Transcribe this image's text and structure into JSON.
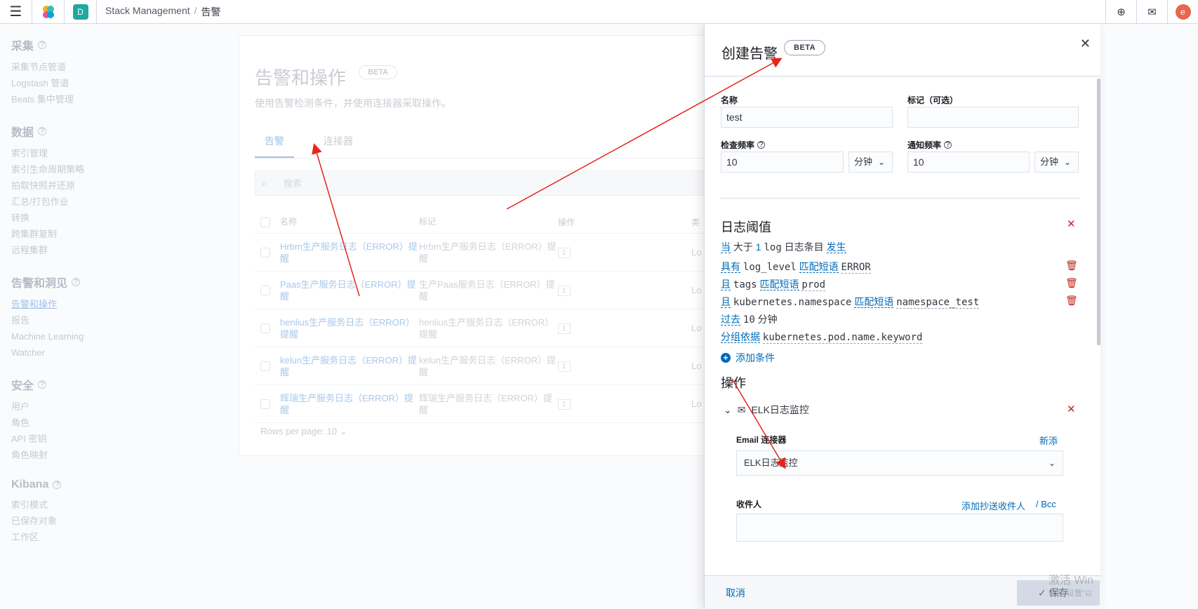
{
  "header": {
    "space_initial": "D",
    "breadcrumbs": [
      "Stack Management",
      "告警"
    ],
    "avatar_initial": "e",
    "icons": [
      "menu-icon",
      "elastic-logo",
      "help-icon",
      "mail-icon"
    ]
  },
  "sidebar": {
    "groups": [
      {
        "title": "采集",
        "items": [
          "采集节点管道",
          "Logstash 管道",
          "Beats 集中管理"
        ]
      },
      {
        "title": "数据",
        "items": [
          "索引管理",
          "索引生命周期策略",
          "拍取快照并还原",
          "汇总/打包作业",
          "转换",
          "跨集群复制",
          "远程集群"
        ]
      },
      {
        "title": "告警和洞见",
        "items": [
          "告警和操作",
          "报告",
          "Machine Learning",
          "Watcher"
        ]
      },
      {
        "title": "安全",
        "items": [
          "用户",
          "角色",
          "API 密钥",
          "角色映射"
        ]
      },
      {
        "title": "Kibana",
        "items": [
          "索引模式",
          "已保存对象",
          "工作区"
        ]
      }
    ]
  },
  "page": {
    "title": "告警和操作",
    "beta": "BETA",
    "description": "使用告警检测条件，并使用连接器采取操作。",
    "tabs": [
      "告警",
      "连接器"
    ],
    "search_placeholder": "搜索",
    "columns": [
      "名称",
      "标记",
      "操作",
      "类"
    ],
    "rows": [
      {
        "name": "Hrbm生产服务日志（ERROR）提醒",
        "tag": "Hrbm生产服务日志（ERROR）提醒",
        "ops": "1",
        "type": "Lo"
      },
      {
        "name": "Paas生产服务日志（ERROR）提醒",
        "tag": "生产Paas服务日志（ERROR）提醒",
        "ops": "1",
        "type": "Lo"
      },
      {
        "name": "henlius生产服务日志（ERROR）提醒",
        "tag": "henlius生产服务日志（ERROR）提醒",
        "ops": "1",
        "type": "Lo"
      },
      {
        "name": "kelun生产服务日志（ERROR）提醒",
        "tag": "kelun生产服务日志（ERROR）提醒",
        "ops": "1",
        "type": "Lo"
      },
      {
        "name": "辉瑞生产服务日志（ERROR）提醒",
        "tag": "辉瑞生产服务日志（ERROR）提醒",
        "ops": "1",
        "type": "Lo"
      }
    ],
    "rows_per_page": "Rows per page: 10"
  },
  "flyout": {
    "title": "创建告警",
    "beta": "BETA",
    "name_label": "名称",
    "name_value": "test",
    "tags_label": "标记（可选）",
    "tags_value": "",
    "check_label": "检查频率",
    "check_value": "10",
    "check_unit": "分钟",
    "notify_label": "通知频率",
    "notify_value": "10",
    "notify_unit": "分钟",
    "threshold_title": "日志阈值",
    "when": {
      "kw": "当",
      "op": "大于",
      "num": "1",
      "unit1": "log",
      "unit2": "日志条目",
      "kw2": "发生"
    },
    "conditions": [
      {
        "kw": "具有",
        "field": "log_level",
        "op": "匹配短语",
        "value": "ERROR"
      },
      {
        "kw": "且",
        "field": "tags",
        "op": "匹配短语",
        "value": "prod"
      },
      {
        "kw": "且",
        "field": "kubernetes.namespace",
        "op": "匹配短语",
        "value": "namespace_test"
      }
    ],
    "past": {
      "kw": "过去",
      "value": "10",
      "unit": "分钟"
    },
    "group_by": {
      "kw": "分组依据",
      "value": "kubernetes.pod.name.keyword"
    },
    "add_condition": "添加条件",
    "actions_title": "操作",
    "action_name": "ELK日志监控",
    "email_connector_label": "Email 连接器",
    "new_link": "新添",
    "connector_value": "ELK日志监控",
    "recipients_label": "收件人",
    "cc_link": "添加抄送收件人",
    "bcc_link": "/ Bcc",
    "cancel": "取消",
    "save": "保存",
    "watermark_1": "激活 Win",
    "watermark_2": "转到\"设置\"以"
  },
  "annotations": {
    "arrow_color": "#e8231a"
  }
}
